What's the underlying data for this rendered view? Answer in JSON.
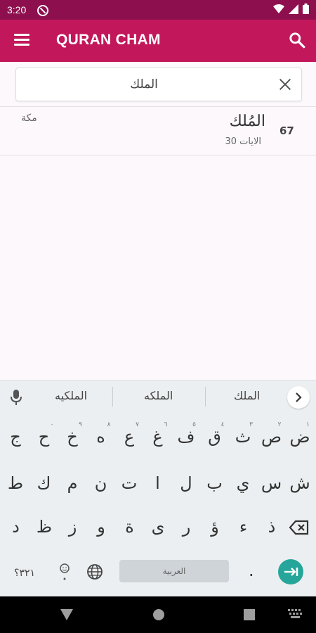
{
  "status": {
    "time": "3:20"
  },
  "app": {
    "title": "QURAN CHAM"
  },
  "search": {
    "query": "الملك"
  },
  "results": [
    {
      "number": "67",
      "name": "المُلك",
      "ayat": "الايات 30",
      "place": "مكة"
    }
  ],
  "keyboard": {
    "suggestions": [
      "الملكيه",
      "الملكه",
      "الملك"
    ],
    "row1": [
      "ض",
      "ص",
      "ث",
      "ق",
      "ف",
      "غ",
      "ع",
      "ه",
      "خ",
      "ح",
      "ج"
    ],
    "row1_hints": [
      "١",
      "٢",
      "٣",
      "٤",
      "٥",
      "٦",
      "٧",
      "٨",
      "٩",
      "٠",
      ""
    ],
    "row2": [
      "ش",
      "س",
      "ي",
      "ب",
      "ل",
      "ا",
      "ت",
      "ن",
      "م",
      "ك",
      "ط"
    ],
    "row3": [
      "ذ",
      "ء",
      "ؤ",
      "ر",
      "ى",
      "ة",
      "و",
      "ز",
      "ظ",
      "د"
    ],
    "numbers_label": "٣٢١؟",
    "space_label": "العربية",
    "period": "."
  }
}
